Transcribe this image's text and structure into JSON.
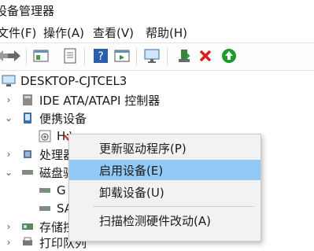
{
  "window": {
    "title": "设备管理器"
  },
  "menubar": {
    "items": [
      "文件(F)",
      "操作(A)",
      "查看(V)",
      "帮助(H)"
    ]
  },
  "toolbar": {
    "icons": [
      "back-arrow",
      "forward-arrow",
      "properties",
      "document",
      "help",
      "run",
      "monitor-scan",
      "update-driver",
      "remove-device",
      "enable-device"
    ]
  },
  "tree": {
    "root": "DESKTOP-CJTCEL3",
    "items": {
      "ide": "IDE ATA/ATAPI 控制器",
      "portable": "便携设备",
      "portable_child": "H:\\",
      "processor": "处理器",
      "disk": "磁盘驱动器",
      "disk_child1": "G",
      "disk_child2": "SA",
      "storage": "存储控制器",
      "printer": "打印队列"
    }
  },
  "context_menu": {
    "items": [
      "更新驱动程序(P)",
      "启用设备(E)",
      "卸载设备(U)",
      "扫描检测硬件改动(A)"
    ],
    "highlighted": "启用设备(E)"
  },
  "colors": {
    "highlight": "#91c9f7",
    "pointer": "#e23b3b",
    "remove": "#d92020",
    "enable": "#1c9c2c"
  }
}
